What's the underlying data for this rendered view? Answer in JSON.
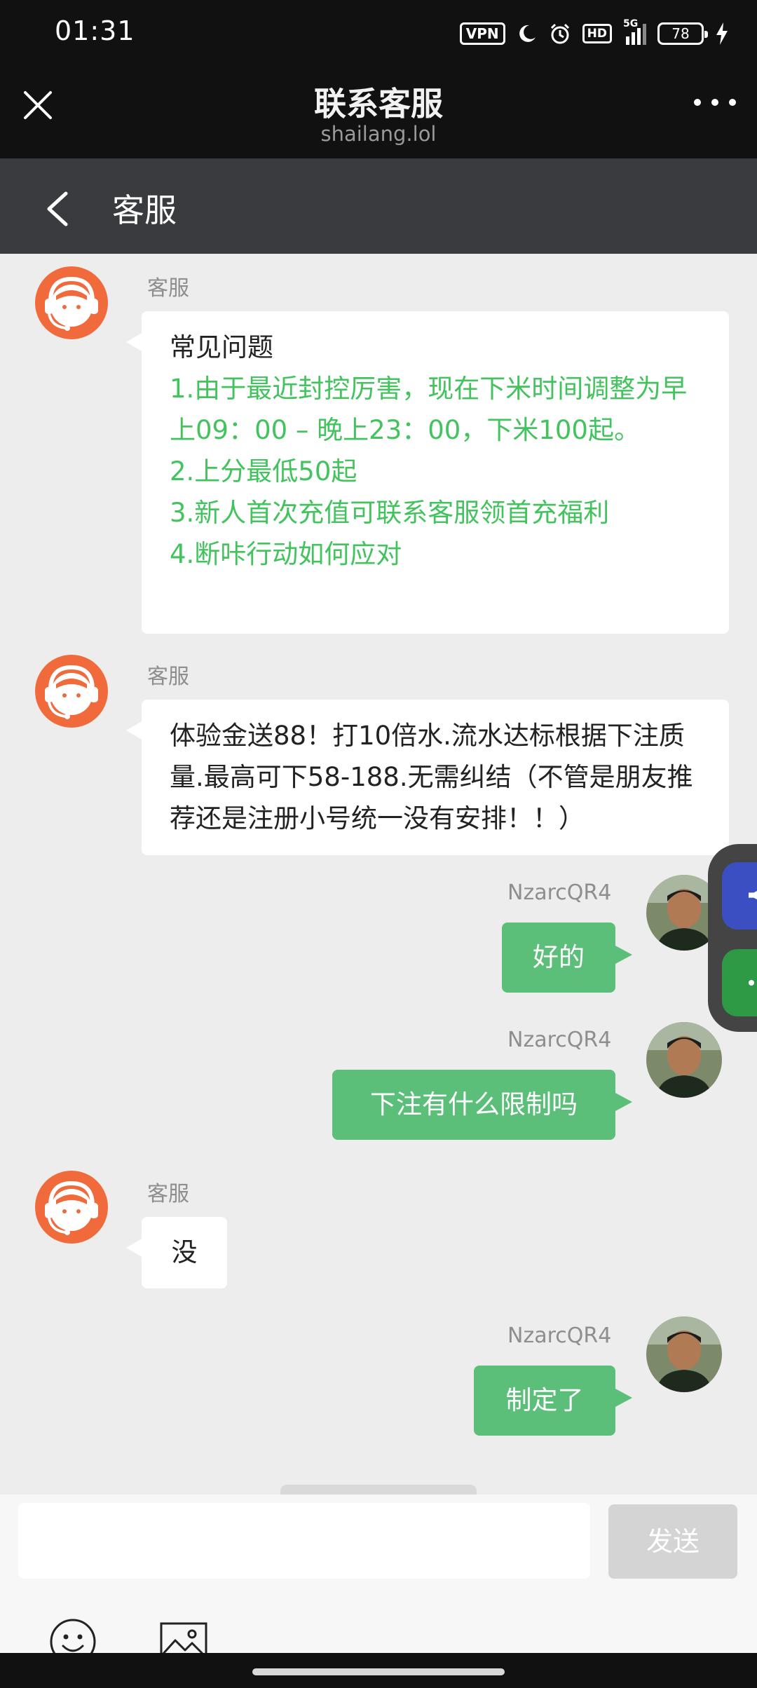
{
  "status_bar": {
    "time": "01:31",
    "vpn": "VPN",
    "hd": "HD",
    "network": "5G",
    "battery": "78"
  },
  "top_nav": {
    "title": "联系客服",
    "subtitle": "shailang.lol",
    "close_icon": "close-icon",
    "more_icon": "more-icon"
  },
  "chat_header": {
    "label": "客服"
  },
  "messages": [
    {
      "sender": "客服",
      "title": "常见问题",
      "lines": [
        "1.由于最近封控厉害，现在下米时间调整为早上09：00 – 晚上23：00，下米100起。",
        "2.上分最低50起",
        "3.新人首次充值可联系客服领首充福利",
        "4.断咔行动如何应对"
      ]
    },
    {
      "sender": "客服",
      "text": "体验金送88！打10倍水.流水达标根据下注质量.最高可下58-188.无需纠结（不管是朋友推荐还是注册小号统一没有安排！！）"
    },
    {
      "sender": "NzarcQR4",
      "text": "好的"
    },
    {
      "sender": "NzarcQR4",
      "text": "下注有什么限制吗"
    },
    {
      "sender": "客服",
      "text": "没"
    },
    {
      "sender": "NzarcQR4",
      "text": "制定了"
    }
  ],
  "input_bar": {
    "placeholder": "",
    "send_label": "发送",
    "emoji_icon": "emoji-icon",
    "image_icon": "image-icon"
  },
  "colors": {
    "outgoing_bubble": "#5cbf79",
    "faq_text": "#43c35e",
    "header_bg": "#3a3b3f",
    "top_bar_bg": "#111111"
  }
}
